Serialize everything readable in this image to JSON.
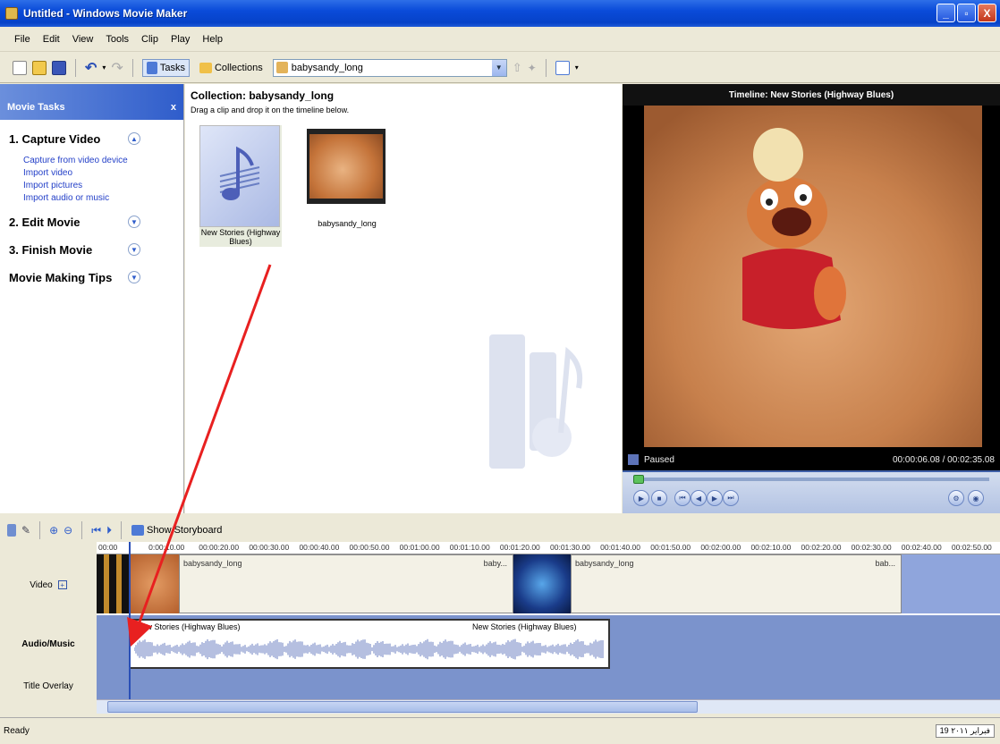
{
  "window": {
    "title": "Untitled - Windows Movie Maker",
    "min": "_",
    "max": "▫",
    "close": "X"
  },
  "menu": [
    "File",
    "Edit",
    "View",
    "Tools",
    "Clip",
    "Play",
    "Help"
  ],
  "toolbar": {
    "tasks": "Tasks",
    "collections": "Collections",
    "collection_value": "babysandy_long"
  },
  "tasks": {
    "header": "Movie Tasks",
    "close": "x",
    "sections": [
      {
        "label": "1. Capture Video",
        "expanded": true,
        "links": [
          "Capture from video device",
          "Import video",
          "Import pictures",
          "Import audio or music"
        ]
      },
      {
        "label": "2. Edit Movie",
        "expanded": false
      },
      {
        "label": "3. Finish Movie",
        "expanded": false
      },
      {
        "label": "Movie Making Tips",
        "expanded": false
      }
    ]
  },
  "collection": {
    "title": "Collection: babysandy_long",
    "subtitle": "Drag a clip and drop it on the timeline below.",
    "clips": [
      {
        "caption": "New Stories (Highway Blues)"
      },
      {
        "caption": "babysandy_long"
      }
    ]
  },
  "preview": {
    "title": "Timeline: New Stories (Highway Blues)",
    "status": "Paused",
    "time": "00:00:06.08 / 00:02:35.08"
  },
  "timeline": {
    "show_storyboard": "Show Storyboard",
    "ruler": [
      "00:00",
      "0:00:10.00",
      "00:00:20.00",
      "00:00:30.00",
      "00:00:40.00",
      "00:00:50.00",
      "00:01:00.00",
      "00:01:10.00",
      "00:01:20.00",
      "00:01:30.00",
      "00:01:40.00",
      "00:01:50.00",
      "00:02:00.00",
      "00:02:10.00",
      "00:02:20.00",
      "00:02:30.00",
      "00:02:40.00",
      "00:02:50.00"
    ],
    "tracks": {
      "video": "Video",
      "audio": "Audio/Music",
      "title": "Title Overlay"
    },
    "video_clips": [
      "babysandy_long",
      "baby...",
      "babysandy_long",
      "bab..."
    ],
    "audio_clips": [
      "New Stories (Highway Blues)",
      "New Stories (Highway Blues)"
    ]
  },
  "status": {
    "text": "Ready",
    "date": "19 فبراير ٢٠١١"
  },
  "colors": {
    "titlebar": "#0a4bd9",
    "tasks_header": "#2f5dcb",
    "link": "#2440c8",
    "track": "#7b93cc",
    "arrow": "#e82020"
  }
}
